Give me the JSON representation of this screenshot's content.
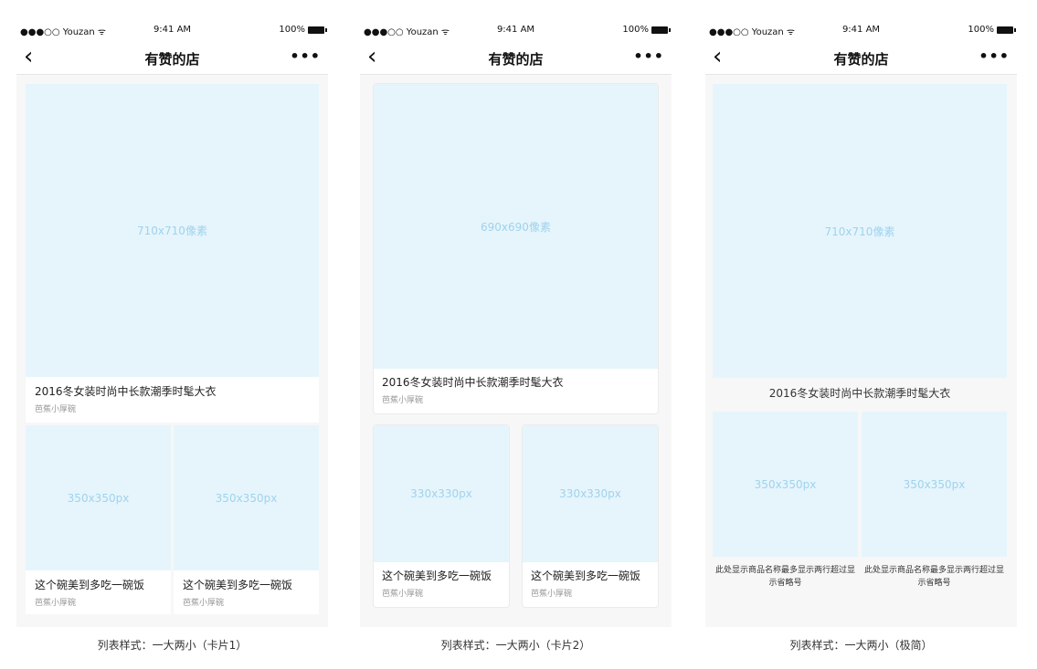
{
  "statusbar": {
    "carrier": "●●●○○ Youzan ᯤ",
    "time": "9:41 AM",
    "battery": "100%"
  },
  "navbar": {
    "back_icon": "‹",
    "title": "有赞的店",
    "more_icon": "•••"
  },
  "phone1": {
    "big": {
      "placeholder": "710x710像素",
      "name": "2016冬女装时尚中长款潮季时髦大衣",
      "shop": "芭蕉小厚碗"
    },
    "smalls": [
      {
        "placeholder": "350x350px",
        "name": "这个碗美到多吃一碗饭",
        "shop": "芭蕉小厚碗"
      },
      {
        "placeholder": "350x350px",
        "name": "这个碗美到多吃一碗饭",
        "shop": "芭蕉小厚碗"
      }
    ],
    "label": "列表样式：一大两小（卡片1）"
  },
  "phone2": {
    "big": {
      "placeholder": "690x690像素",
      "name": "2016冬女装时尚中长款潮季时髦大衣",
      "shop": "芭蕉小厚碗"
    },
    "smalls": [
      {
        "placeholder": "330x330px",
        "name": "这个碗美到多吃一碗饭",
        "shop": "芭蕉小厚碗"
      },
      {
        "placeholder": "330x330px",
        "name": "这个碗美到多吃一碗饭",
        "shop": "芭蕉小厚碗"
      }
    ],
    "label": "列表样式：一大两小（卡片2）"
  },
  "phone3": {
    "big": {
      "placeholder": "710x710像素",
      "name": "2016冬女装时尚中长款潮季时髦大衣"
    },
    "smalls": [
      {
        "placeholder": "350x350px",
        "name": "此处显示商品名称最多显示两行超过显示省略号"
      },
      {
        "placeholder": "350x350px",
        "name": "此处显示商品名称最多显示两行超过显示省略号"
      }
    ],
    "label": "列表样式：一大两小（极简）"
  }
}
